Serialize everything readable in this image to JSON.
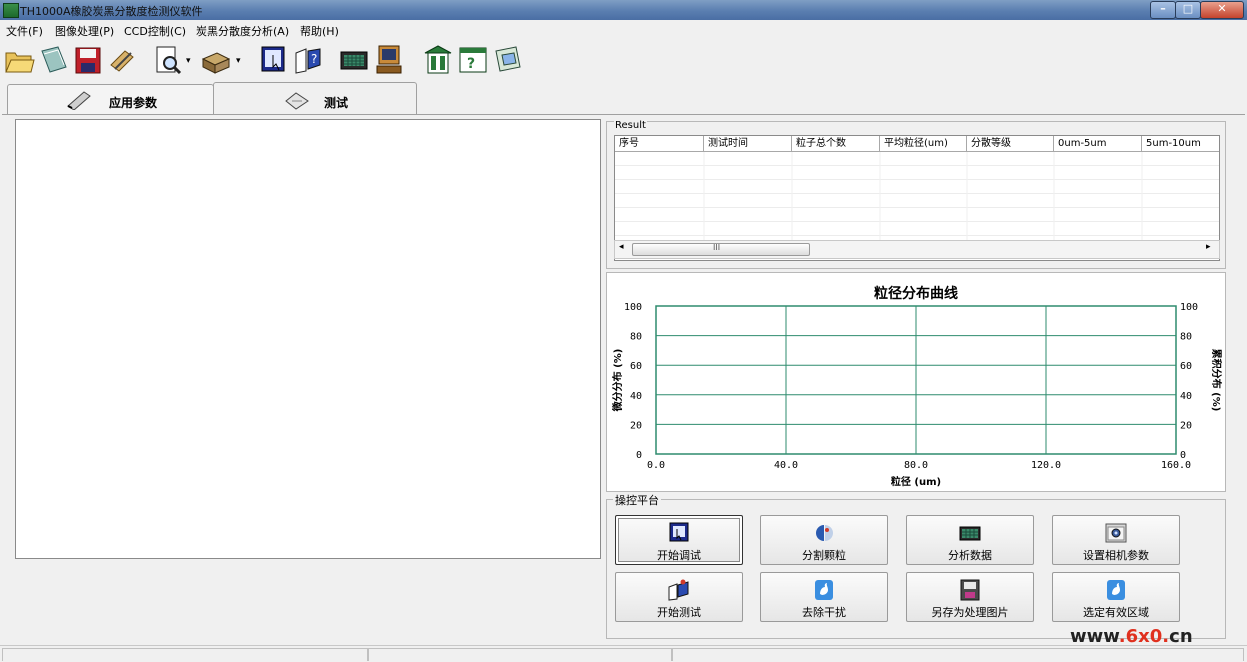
{
  "window": {
    "title": "TH1000A橡胶炭黑分散度检测仪软件"
  },
  "menu": {
    "items": [
      "文件(F)",
      "图像处理(P)",
      "CCD控制(C)",
      "炭黑分散度分析(A)",
      "帮助(H)"
    ]
  },
  "toolbar": {
    "icons": [
      "open-folder-icon",
      "open-file-icon",
      "save-icon",
      "edit-icon",
      "print-preview-icon",
      "printer-icon",
      "monitor-select-icon",
      "help-cursor-icon",
      "calculator-icon",
      "computer-icon",
      "building-icon",
      "help-book-icon",
      "info-icon"
    ]
  },
  "tabs": [
    {
      "label": "应用参数",
      "icon": "pencil-icon",
      "active": false
    },
    {
      "label": "测试",
      "icon": "pen-tool-icon",
      "active": true
    }
  ],
  "result": {
    "legend": "Result",
    "columns": [
      "序号",
      "测试时间",
      "粒子总个数",
      "平均粒径(um)",
      "分散等级",
      "0um-5um",
      "5um-10um"
    ],
    "rows": [],
    "scroll_marker": "III"
  },
  "chart_data": {
    "type": "line",
    "title": "粒径分布曲线",
    "xlabel": "粒径 (um)",
    "ylabel": "微分分布 (%)",
    "y2label": "累积分布 (%)",
    "xlim": [
      0,
      160
    ],
    "ylim": [
      0,
      100
    ],
    "y2lim": [
      0,
      100
    ],
    "xticks": [
      "0.0",
      "40.0",
      "80.0",
      "120.0",
      "160.0"
    ],
    "yticks": [
      "0",
      "20",
      "40",
      "60",
      "80",
      "100"
    ],
    "y2ticks": [
      "0",
      "20",
      "40",
      "60",
      "80",
      "100"
    ],
    "grid": true,
    "series": [],
    "colors": {
      "grid": "#2e8b6e",
      "frame": "#2e8b6e"
    }
  },
  "control": {
    "legend": "操控平台",
    "buttons": [
      {
        "label": "开始调试",
        "icon": "debug-monitor-icon",
        "focused": true
      },
      {
        "label": "分割颗粒",
        "icon": "particle-split-icon",
        "focused": false
      },
      {
        "label": "分析数据",
        "icon": "calculator-icon",
        "focused": false
      },
      {
        "label": "设置相机参数",
        "icon": "camera-icon",
        "focused": false
      },
      {
        "label": "开始测试",
        "icon": "test-start-icon",
        "focused": false
      },
      {
        "label": "去除干扰",
        "icon": "remove-noise-icon",
        "focused": false
      },
      {
        "label": "另存为处理图片",
        "icon": "save-image-icon",
        "focused": false
      },
      {
        "label": "选定有效区域",
        "icon": "select-region-icon",
        "focused": false
      }
    ]
  },
  "watermark": {
    "url": "www.6x0.cn",
    "colors": {
      "dark": "#222222",
      "red": "#e0301e"
    }
  }
}
